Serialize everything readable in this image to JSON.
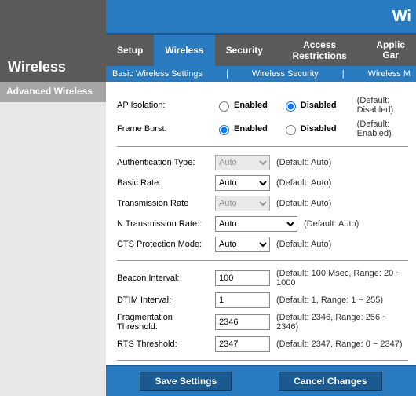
{
  "header": {
    "section_title": "Wireless",
    "banner_truncated": "Wi"
  },
  "nav": {
    "items": [
      "Setup",
      "Wireless",
      "Security",
      "Access Restrictions"
    ],
    "partial": {
      "line1": "Applic",
      "line2": "Gar"
    },
    "active_index": 1
  },
  "subnav": {
    "items": [
      "Basic Wireless Settings",
      "Wireless Security",
      "Wireless M"
    ]
  },
  "sidebar": {
    "title": "Advanced Wireless"
  },
  "fields": {
    "ap_isolation": {
      "label": "AP Isolation:",
      "opt_enabled": "Enabled",
      "opt_disabled": "Disabled",
      "value": "disabled",
      "hint": "(Default: Disabled)"
    },
    "frame_burst": {
      "label": "Frame Burst:",
      "opt_enabled": "Enabled",
      "opt_disabled": "Disabled",
      "value": "enabled",
      "hint": "(Default: Enabled)"
    },
    "auth_type": {
      "label": "Authentication Type:",
      "value": "Auto",
      "hint": "(Default: Auto)"
    },
    "basic_rate": {
      "label": "Basic Rate:",
      "value": "Auto",
      "hint": "(Default: Auto)"
    },
    "trans_rate": {
      "label": "Transmission Rate",
      "value": "Auto",
      "hint": "(Default: Auto)"
    },
    "n_trans_rate": {
      "label": "N Transmission Rate::",
      "value": "Auto",
      "hint": "(Default: Auto)"
    },
    "cts_mode": {
      "label": "CTS Protection Mode:",
      "value": "Auto",
      "hint": "(Default: Auto)"
    },
    "beacon": {
      "label": "Beacon Interval:",
      "value": "100",
      "hint": "(Default: 100 Msec, Range: 20 ~ 1000"
    },
    "dtim": {
      "label": "DTIM Interval:",
      "value": "1",
      "hint": "(Default: 1, Range: 1 ~ 255)"
    },
    "frag": {
      "label": "Fragmentation Threshold:",
      "value": "2346",
      "hint": "(Default: 2346, Range: 256 ~ 2346)"
    },
    "rts": {
      "label": "RTS Threshold:",
      "value": "2347",
      "hint": "(Default: 2347, Range: 0 ~ 2347)"
    }
  },
  "footer": {
    "save": "Save Settings",
    "cancel": "Cancel Changes"
  }
}
